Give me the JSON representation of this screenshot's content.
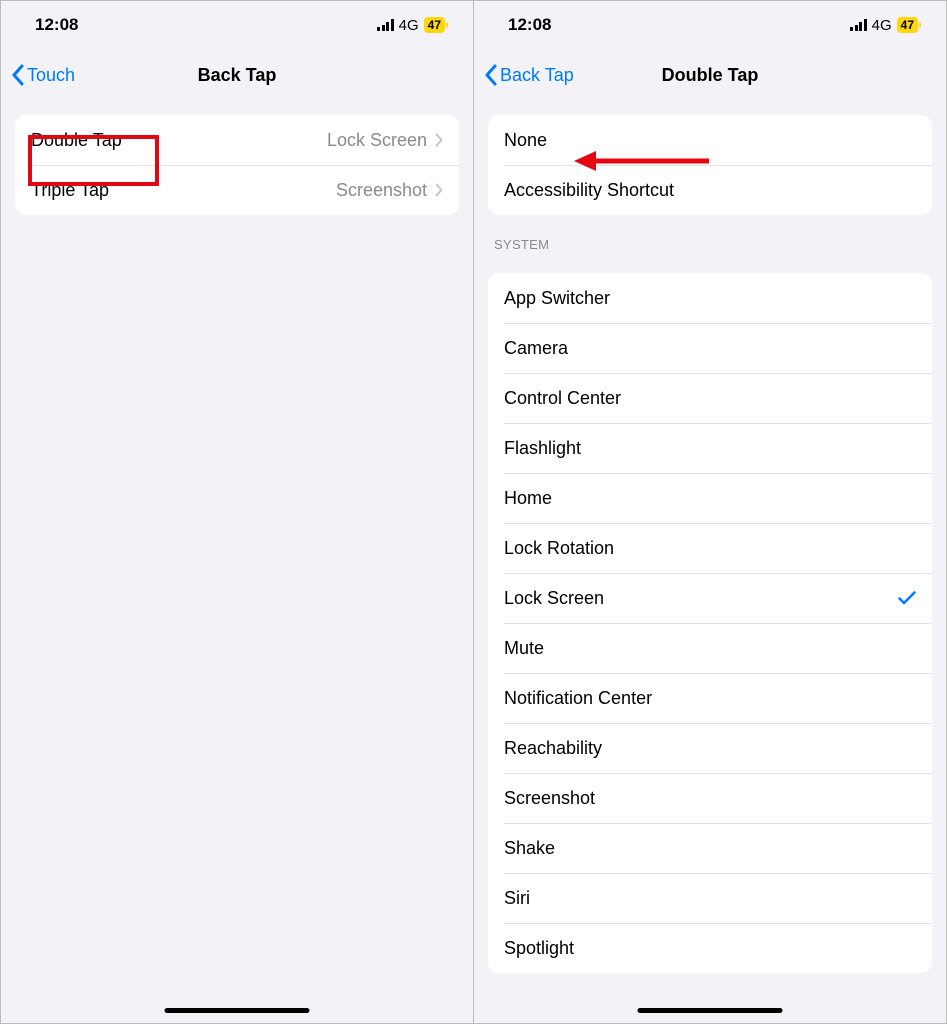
{
  "status": {
    "time": "12:08",
    "network": "4G",
    "battery": "47"
  },
  "left": {
    "back": "Touch",
    "title": "Back Tap",
    "rows": [
      {
        "label": "Double Tap",
        "value": "Lock Screen"
      },
      {
        "label": "Triple Tap",
        "value": "Screenshot"
      }
    ]
  },
  "right": {
    "back": "Back Tap",
    "title": "Double Tap",
    "group1": [
      {
        "label": "None"
      },
      {
        "label": "Accessibility Shortcut"
      }
    ],
    "systemHeader": "System",
    "system": [
      {
        "label": "App Switcher"
      },
      {
        "label": "Camera"
      },
      {
        "label": "Control Center"
      },
      {
        "label": "Flashlight"
      },
      {
        "label": "Home"
      },
      {
        "label": "Lock Rotation"
      },
      {
        "label": "Lock Screen",
        "selected": true
      },
      {
        "label": "Mute"
      },
      {
        "label": "Notification Center"
      },
      {
        "label": "Reachability"
      },
      {
        "label": "Screenshot"
      },
      {
        "label": "Shake"
      },
      {
        "label": "Siri"
      },
      {
        "label": "Spotlight"
      }
    ]
  }
}
